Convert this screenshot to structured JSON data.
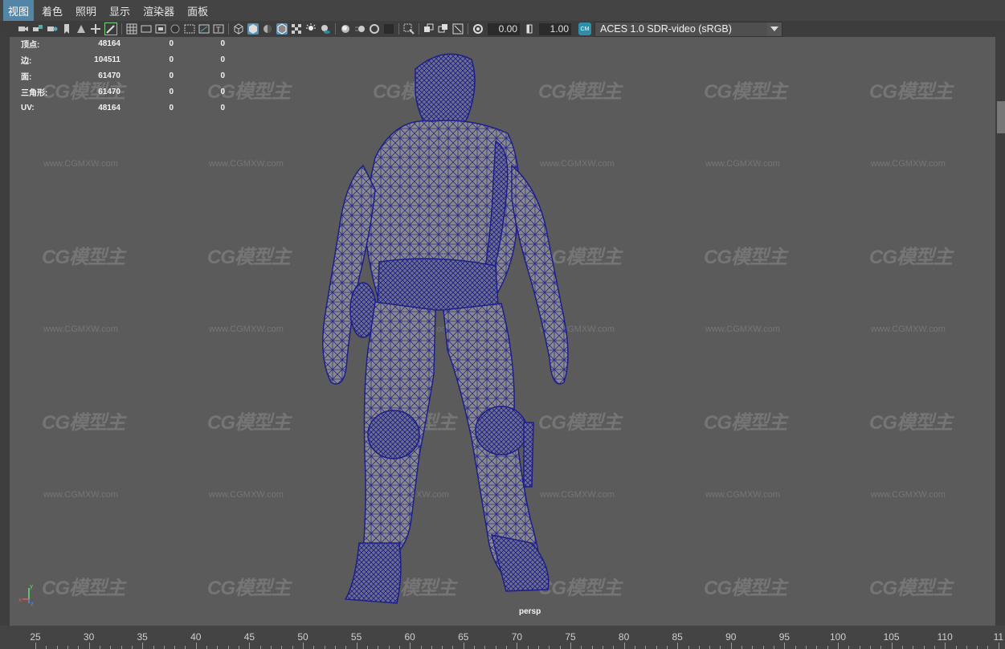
{
  "menu": {
    "items": [
      "视图",
      "着色",
      "照明",
      "显示",
      "渲染器",
      "面板"
    ],
    "active_index": 0
  },
  "toolbar": {
    "icons": [
      "camera-icon",
      "camera-lock-icon",
      "camera-attr-icon",
      "bookmark-icon",
      "image-plane-icon",
      "grid-2d-pan-icon",
      "grease-pencil-icon",
      "grid-icon",
      "film-gate-icon",
      "resolution-gate-icon",
      "gate-mask-icon",
      "field-chart-icon",
      "safe-action-icon",
      "safe-title-icon",
      "wireframe-icon",
      "smooth-shade-icon",
      "shade-all-icon",
      "wireframe-on-shaded-icon",
      "textured-icon",
      "use-lights-icon",
      "shadows-icon",
      "ambient-occlusion-icon",
      "motion-blur-icon",
      "multisample-icon",
      "depth-of-field-icon",
      "isolate-select-icon",
      "xray-icon",
      "xray-active-icon",
      "xray-joints-icon",
      "backface-cull-icon",
      "exposure-icon",
      "gamma-icon"
    ],
    "exposure_value": "0.00",
    "gamma_value": "1.00",
    "color_management": "ACES 1.0 SDR-video (sRGB)"
  },
  "hud": {
    "rows": [
      {
        "label": "顶点:",
        "v1": "48164",
        "v2": "0",
        "v3": "0"
      },
      {
        "label": "边:",
        "v1": "104511",
        "v2": "0",
        "v3": "0"
      },
      {
        "label": "面:",
        "v1": "61470",
        "v2": "0",
        "v3": "0"
      },
      {
        "label": "三角形:",
        "v1": "61470",
        "v2": "0",
        "v3": "0"
      },
      {
        "label": "UV:",
        "v1": "48164",
        "v2": "0",
        "v3": "0"
      }
    ]
  },
  "viewport": {
    "camera": "persp",
    "watermark_logo": "CG模型主",
    "watermark_url": "www.CGMXW.com",
    "wire_color": "#1d1f8a",
    "mesh_fill": "#8a8a8a"
  },
  "axis": {
    "x": "x",
    "y": "y",
    "z": "z"
  },
  "timeline": {
    "ticks": [
      "25",
      "30",
      "35",
      "40",
      "45",
      "50",
      "55",
      "60",
      "65",
      "70",
      "75",
      "80",
      "85",
      "90",
      "95",
      "100",
      "105",
      "110",
      "11"
    ]
  }
}
